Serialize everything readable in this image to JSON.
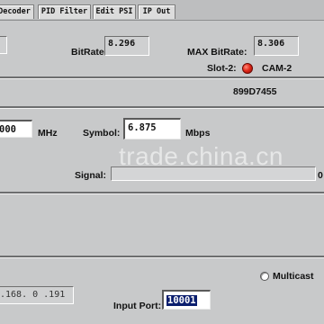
{
  "tabs": [
    {
      "label": "Decoder"
    },
    {
      "label": "PID Filter"
    },
    {
      "label": "Edit PSI"
    },
    {
      "label": "IP Out"
    }
  ],
  "status": {
    "bitrate_label": "BitRate:",
    "bitrate_value": "8.296",
    "max_bitrate_label": "MAX BitRate:",
    "max_bitrate_value": "8.306",
    "slot_label": "Slot-2:",
    "slot_cam": "CAM-2",
    "slot_led_color": "#e32a1a",
    "card_id": "899D7455"
  },
  "tuner": {
    "frequency_value": "000",
    "frequency_unit": "MHz",
    "symbol_label": "Symbol:",
    "symbol_value": "6.875",
    "symbol_unit": "Mbps",
    "signal_label": "Signal:",
    "signal_value": "0"
  },
  "watermark": "trade.china.cn",
  "output": {
    "multicast_label": "Multicast",
    "ip_value": ".168. 0 .191",
    "input_port_label": "Input Port:",
    "input_port_value": "10001"
  }
}
